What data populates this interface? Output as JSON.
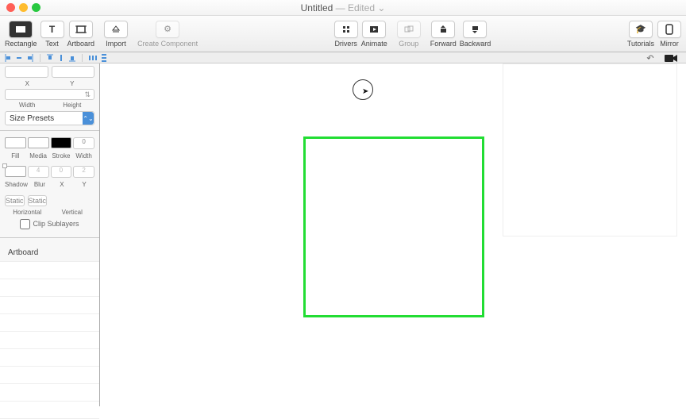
{
  "window": {
    "title": "Untitled",
    "edited": "— Edited",
    "caret": "⌄"
  },
  "toolbar": {
    "rectangle": "Rectangle",
    "text": "Text",
    "artboard": "Artboard",
    "import": "Import",
    "create_component": "Create Component",
    "drivers": "Drivers",
    "animate": "Animate",
    "group": "Group",
    "forward": "Forward",
    "backward": "Backward",
    "tutorials": "Tutorials",
    "mirror": "Mirror"
  },
  "inspector": {
    "x_label": "X",
    "y_label": "Y",
    "width_label": "Width",
    "height_label": "Height",
    "link_icon": "⇅",
    "size_presets": "Size Presets",
    "fill": "Fill",
    "media": "Media",
    "stroke": "Stroke",
    "swidth": "Width",
    "shadow": "Shadow",
    "blur": "Blur",
    "sx": "X",
    "sy": "Y",
    "shadow_blur_val": "4",
    "shadow_x_val": "0",
    "shadow_y_val": "2",
    "stroke_width_val": "0",
    "horizontal": "Horizontal",
    "vertical": "Vertical",
    "static": "Static",
    "clip_sublayers": "Clip Sublayers"
  },
  "layers": {
    "artboard": "Artboard"
  },
  "canvas_tools": {
    "undo": "↶",
    "camera": "📹"
  }
}
